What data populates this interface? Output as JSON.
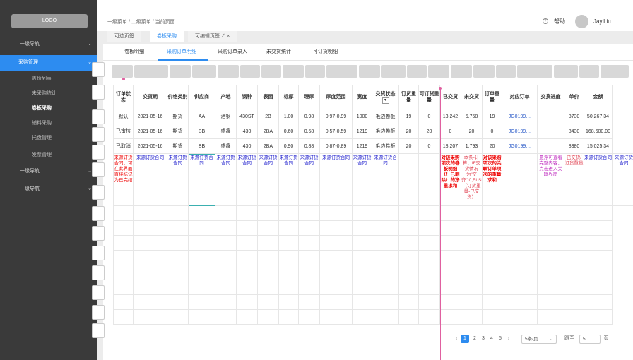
{
  "sidebar": {
    "logo": "LOGO",
    "items": [
      {
        "label": "一级导航",
        "chev": "⌄"
      },
      {
        "label": "采购管理",
        "chev": "⌄"
      },
      {
        "label": "盖价列表"
      },
      {
        "label": "未采购统计"
      },
      {
        "label": "卷板采购"
      },
      {
        "label": "辅料采购"
      },
      {
        "label": "托盘管理"
      },
      {
        "label": "发票管理"
      },
      {
        "label": "一级导航",
        "chev": "⌄"
      },
      {
        "label": "一级导航",
        "chev": "⌄"
      }
    ]
  },
  "header": {
    "breadcrumb": "一级菜单 / 二级菜单 / 当前页面",
    "help": "帮助",
    "help_icon": "?",
    "user": "Jay.Liu"
  },
  "tabs": [
    "可选页签",
    "卷板采购",
    "可编辑页签 ∠ ×"
  ],
  "subtabs": [
    "卷板明细",
    "采购订单明细",
    "采购订单录入",
    "未交货统计",
    "可订货明细"
  ],
  "table": {
    "headers": [
      "订单状态",
      "交货期",
      "价格类别",
      "供应商",
      "产地",
      "钢种",
      "表面",
      "标厚",
      "理厚",
      "厚度范围",
      "宽度",
      "交货状态",
      "订货重量",
      "可订货重量",
      "已交货",
      "未交货",
      "订单重量",
      "对应订单",
      "交货进度",
      "单价",
      "金额"
    ],
    "rows": [
      [
        "默认",
        "2021-05-16",
        "期货",
        "AA",
        "酒钢",
        "430ST",
        "2B",
        "1.00",
        "0.98",
        "0.97-0.99",
        "1000",
        "毛边卷板",
        "19",
        "0",
        "13.242",
        "5.758",
        "19",
        "JG0199…",
        "",
        "8730",
        "50,267.34"
      ],
      [
        "已审核",
        "2021-05-16",
        "期货",
        "BB",
        "盛鑫",
        "430",
        "2BA",
        "0.60",
        "0.58",
        "0.57-0.59",
        "1219",
        "毛边卷板",
        "20",
        "20",
        "0",
        "20",
        "0",
        "JG0199…",
        "",
        "8430",
        "168,600.00"
      ],
      [
        "已取消",
        "2021-05-16",
        "期货",
        "BB",
        "盛鑫",
        "430",
        "2BA",
        "0.90",
        "0.88",
        "0.87-0.89",
        "1219",
        "毛边卷板",
        "20",
        "0",
        "18.207",
        "1.793",
        "20",
        "JG0199…",
        "",
        "8380",
        "15,025.34"
      ]
    ],
    "notes": [
      "来源订货合同，可在此界面直接标记为已完结",
      "来源订货合同",
      "来源订货合同",
      "来源订货合同",
      "来源订货合同",
      "来源订货合同",
      "来源订货合同",
      "来源订货合同",
      "来源订货合同",
      "来源订货合同",
      "来源订货合同",
      "来源订货合同",
      "",
      "",
      "对该采购项次的卷板明细（！已删除）的净重求和",
      "本条-计算：IF交货情况为\"交齐\",0,ELSE（订货重量-已交货）",
      "对该采购项次的关联订单项次的重量求和",
      "",
      "悬浮可查看完整内容，点击进入关联界面",
      "已交货/订货重量",
      "来源订货合同",
      "来源订货合同"
    ]
  },
  "pagination": {
    "prev": "‹",
    "pages": [
      "1",
      "2",
      "3",
      "4",
      "5"
    ],
    "next": "›",
    "page_size": "5条/页",
    "goto_label": "跳至",
    "goto_value": "5",
    "page_unit": "页"
  }
}
